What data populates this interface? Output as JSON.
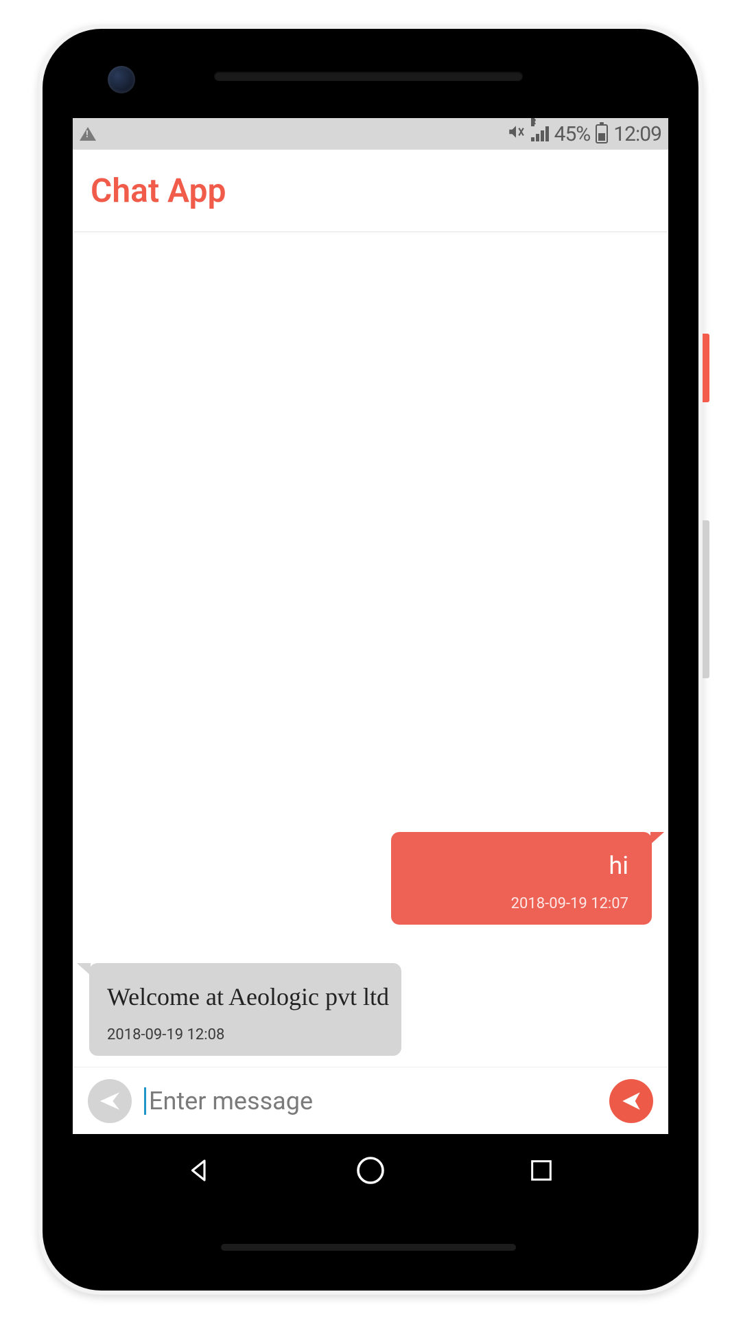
{
  "status": {
    "battery_pct": "45%",
    "clock": "12:09",
    "network_label": "R"
  },
  "appbar": {
    "title": "Chat App"
  },
  "messages": [
    {
      "side": "sent",
      "text": "hi",
      "timestamp": "2018-09-19 12:07"
    },
    {
      "side": "received",
      "text": "Welcome at Aeologic pvt ltd",
      "timestamp": "2018-09-19 12:08"
    }
  ],
  "compose": {
    "placeholder": "Enter message",
    "value": ""
  },
  "colors": {
    "accent": "#ee6155",
    "title": "#f15b4a",
    "bubble_received": "#d5d5d5",
    "status_bar": "#d7d7d7",
    "send_button": "#ee5a48"
  }
}
